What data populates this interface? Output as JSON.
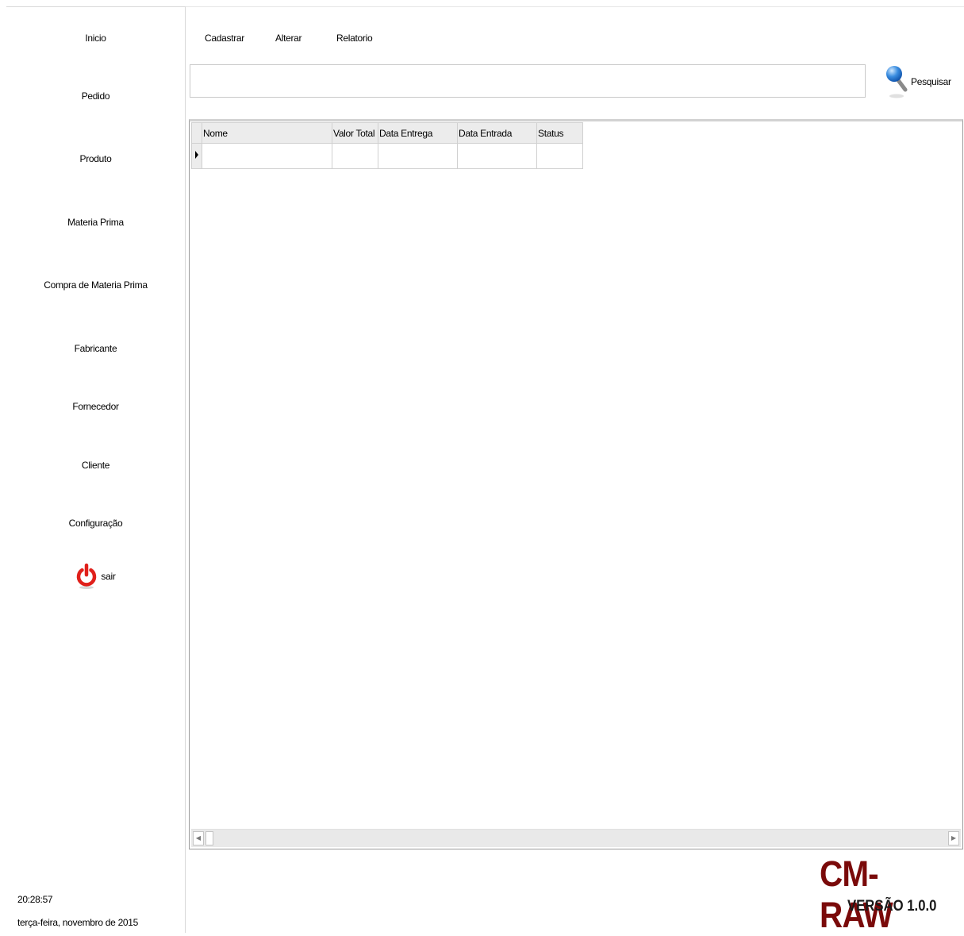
{
  "sidebar": {
    "items": [
      {
        "label": "Inicio"
      },
      {
        "label": "Pedido"
      },
      {
        "label": "Produto"
      },
      {
        "label": "Materia Prima"
      },
      {
        "label": "Compra de Materia Prima"
      },
      {
        "label": "Fabricante"
      },
      {
        "label": "Fornecedor"
      },
      {
        "label": "Cliente"
      },
      {
        "label": "Configuração"
      }
    ],
    "exit_label": "sair",
    "exit_icon": "power-icon",
    "exit_icon_color": "#e0201b",
    "clock": "20:28:57",
    "date": "terça-feira, novembro de 2015"
  },
  "toolbar": {
    "cadastrar": "Cadastrar",
    "alterar": "Alterar",
    "relatorio": "Relatorio"
  },
  "search": {
    "value": "",
    "placeholder": "",
    "button_label": "Pesquisar",
    "button_icon": "magnifier-icon"
  },
  "grid": {
    "columns": [
      "Nome",
      "Valor Total",
      "Data Entrega",
      "Data Entrada",
      "Status"
    ],
    "rows": [
      [
        "",
        "",
        "",
        "",
        ""
      ]
    ]
  },
  "brand": {
    "name": "CM-RAW",
    "version": "VERSÃO 1.0.0",
    "color": "#7a0a0a"
  }
}
